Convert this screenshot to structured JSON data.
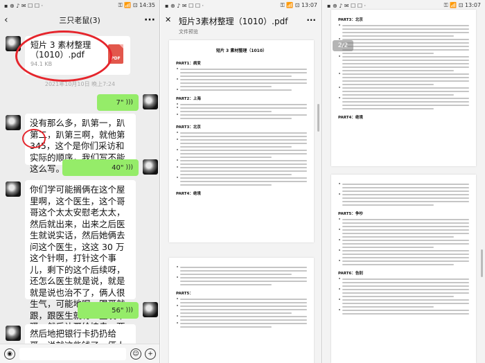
{
  "chat": {
    "status": {
      "left": "▪ ⊕ ♪ ✉ ☐ ☐ ·",
      "right": "⚿ 📶 ⊡ 14:35"
    },
    "title": "三只老鼠(3)",
    "back_icon": "‹",
    "more_icon": "···",
    "file": {
      "name": "短片 3 素材整理（1010）.pdf",
      "size": "94.1 KB",
      "icon_label": "PDF"
    },
    "timestamp": "2021年10月10日 晚上7:24",
    "voices": [
      {
        "duration": "7\""
      },
      {
        "duration": "40\""
      },
      {
        "duration": "56\""
      }
    ],
    "messages": [
      "没有那么多，趴第一，趴第二，趴第三啊，就他第 345，这个是你们采访和实际的顺序，我们写不能这么写。",
      "你们学可能搁俩在这个屋里啊，这个医生，这个哥哥这个太太安慰老太太，然后就出来，出来之后医生就说实话，然后她俩去问这个医生，这这 30 万这个针啊，打针这个事儿，剩下的这个后续呀，还怎么医生就是说，就是就是说也治不了，俩人很生气，可能地呢，跟哥就跟，跟医生就有一些发牢骚，然后让哥给拽走，两个人到走廊，然后呢，两个人就产生了争执，包括这个医药费呀，卖房子啊，看中医呀，尽全力呀。",
      "然后地把银行卡扔扔给哥，说就这些钱了，俩人就吵起来，导致动手动脚这个时候，然后就出来的"
    ],
    "input": {
      "voice_icon": "◉",
      "emoji_icon": "☺",
      "plus_icon": "+"
    }
  },
  "doc1": {
    "status": {
      "left": "▪ ⊕ ♪ ✉ ☐ ☐ ·",
      "right": "⚿ 📶 ⊡ 13:07"
    },
    "title": "短片3素材整理（1010）.pdf",
    "subtitle": "文件预览",
    "close_icon": "✕",
    "more_icon": "···",
    "page_title": "短片 3 素材整理（1010）",
    "parts": [
      "PART1：病变",
      "PART2：上海",
      "PART3：北京",
      "PART4：绝境",
      "PART5："
    ]
  },
  "doc2": {
    "status": {
      "left": "▪ ⊕ ♪ ✉ ☐ ☐ ·",
      "right": "⚿ 📶 ⊡ 13:07"
    },
    "page_indicator": "2/2",
    "parts": [
      "PART3：北京",
      "PART4：绝境",
      "PART5：争吵",
      "PART6：告别"
    ]
  },
  "colors": {
    "voice_bubble": "#95ec69",
    "annotation": "#e5252c",
    "pdf_icon": "#e2574c"
  }
}
